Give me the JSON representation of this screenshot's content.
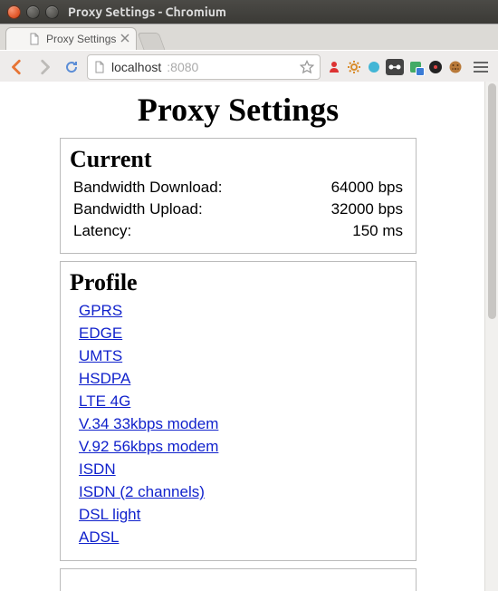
{
  "window": {
    "title": "Proxy Settings - Chromium"
  },
  "tab": {
    "title": "Proxy Settings"
  },
  "url": {
    "host": "localhost",
    "port": ":8080"
  },
  "page": {
    "title": "Proxy Settings",
    "current": {
      "heading": "Current",
      "rows": [
        {
          "label": "Bandwidth Download:",
          "value": "64000 bps"
        },
        {
          "label": "Bandwidth Upload:",
          "value": "32000 bps"
        },
        {
          "label": "Latency:",
          "value": "150 ms"
        }
      ]
    },
    "profile": {
      "heading": "Profile",
      "items": [
        "GPRS",
        "EDGE",
        "UMTS",
        "HSDPA",
        "LTE 4G",
        "V.34 33kbps modem",
        "V.92 56kbps modem",
        "ISDN",
        "ISDN (2 channels)",
        "DSL light",
        "ADSL"
      ]
    }
  }
}
